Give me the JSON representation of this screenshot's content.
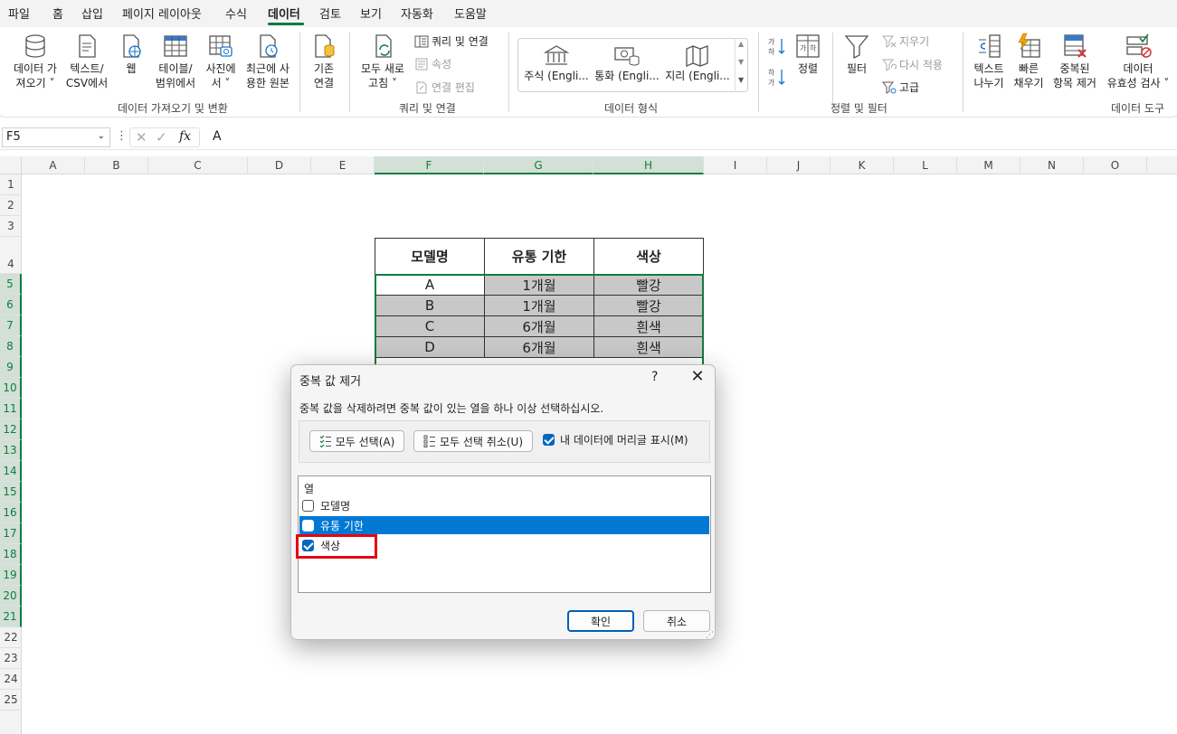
{
  "menu": {
    "items": [
      "파일",
      "홈",
      "삽입",
      "페이지 레이아웃",
      "수식",
      "데이터",
      "검토",
      "보기",
      "자동화",
      "도움말"
    ],
    "active_index": 5
  },
  "ribbon": {
    "get_data": {
      "line1": "데이터 가",
      "line2": "져오기 ˅"
    },
    "text_csv": {
      "line1": "텍스트/",
      "line2": "CSV에서"
    },
    "web": {
      "line1": "웹"
    },
    "table_range": {
      "line1": "테이블/",
      "line2": "범위에서"
    },
    "from_picture": {
      "line1": "사진에",
      "line2": "서 ˅"
    },
    "recent_sources": {
      "line1": "최근에 사",
      "line2": "용한 원본"
    },
    "existing_conn": {
      "line1": "기존",
      "line2": "연결"
    },
    "group_get_transform": "데이터 가져오기 및 변환",
    "refresh_all": {
      "line1": "모두 새로",
      "line2": "고침 ˅"
    },
    "queries_connections": "쿼리 및 연결",
    "properties": "속성",
    "edit_links": "연결 편집",
    "group_queries": "쿼리 및 연결",
    "datatypes": [
      "주식 (Engli...",
      "통화 (Engli...",
      "지리 (Engli..."
    ],
    "group_datatypes": "데이터 형식",
    "sort": "정렬",
    "filter": "필터",
    "clear": "지우기",
    "reapply": "다시 적용",
    "advanced": "고급",
    "group_sort_filter": "정렬 및 필터",
    "text_to_columns": {
      "line1": "텍스트",
      "line2": "나누기"
    },
    "flash_fill": {
      "line1": "빠른",
      "line2": "채우기"
    },
    "remove_duplicates": {
      "line1": "중복된",
      "line2": "항목 제거"
    },
    "data_validation": {
      "line1": "데이터",
      "line2": "유효성 검사 ˅"
    },
    "group_data_tools": "데이터 도구",
    "accent_color": "#107c41"
  },
  "formula_bar": {
    "name_box": "F5",
    "fx_label": "fx",
    "value": "A"
  },
  "sheet": {
    "columns": [
      "A",
      "B",
      "C",
      "D",
      "E",
      "F",
      "G",
      "H",
      "I",
      "J",
      "K",
      "L",
      "M",
      "N",
      "O"
    ],
    "rows": [
      "1",
      "2",
      "3",
      "4",
      "5",
      "6",
      "7",
      "8",
      "9",
      "10",
      "11",
      "12",
      "13",
      "14",
      "15",
      "16",
      "17",
      "18",
      "19",
      "20",
      "21",
      "22",
      "23",
      "24",
      "25"
    ],
    "table": {
      "headers": [
        "모델명",
        "유통 기한",
        "색상"
      ],
      "rows": [
        [
          "A",
          "1개월",
          "빨강"
        ],
        [
          "B",
          "1개월",
          "빨강"
        ],
        [
          "C",
          "6개월",
          "흰색"
        ],
        [
          "D",
          "6개월",
          "흰색"
        ]
      ]
    }
  },
  "dialog": {
    "title": "중복 값 제거",
    "help": "?",
    "close": "✕",
    "instruction": "중복 값을 삭제하려면 중복 값이 있는 열을 하나 이상 선택하십시오.",
    "select_all": "모두 선택(A)",
    "unselect_all": "모두 선택 취소(U)",
    "header_option": "내 데이터에 머리글 표시(M)",
    "header_option_checked": true,
    "list_heading": "열",
    "columns": [
      {
        "label": "모델명",
        "checked": false
      },
      {
        "label": "유통 기한",
        "checked": false
      },
      {
        "label": "색상",
        "checked": true
      }
    ],
    "ok": "확인",
    "cancel": "취소",
    "highlight_color": "#e30613",
    "selection_color": "#0078d4"
  }
}
